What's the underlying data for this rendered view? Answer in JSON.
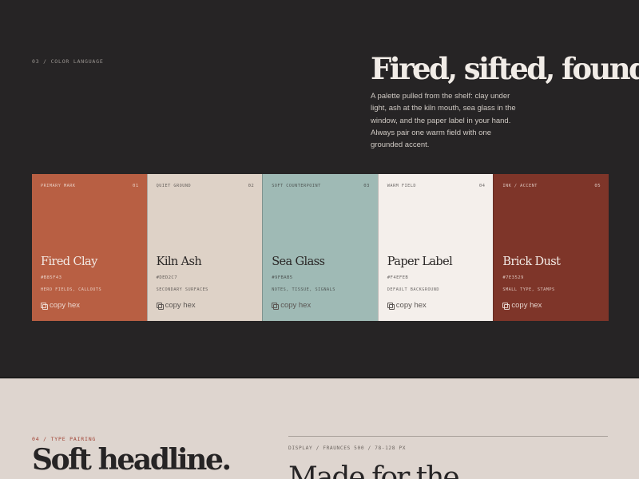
{
  "color_section": {
    "eyebrow": "03 / COLOR LANGUAGE",
    "headline": "Fired, sifted, found.",
    "lede": "A palette pulled from the shelf: clay under light, ash at the kiln mouth, sea glass in the window, and the paper label in your hand. Always pair one warm field with one grounded accent.",
    "copy_label": "copy hex",
    "swatches": [
      {
        "role": "PRIMARY MARK",
        "num": "01",
        "name": "Fired Clay",
        "hex": "#B85F43",
        "use": "HERO FIELDS, CALLOUTS",
        "color": "#B85F43",
        "tone": "on-dark"
      },
      {
        "role": "QUIET GROUND",
        "num": "02",
        "name": "Kiln Ash",
        "hex": "#DED2C7",
        "use": "SECONDARY SURFACES",
        "color": "#DED2C7",
        "tone": "on-light"
      },
      {
        "role": "SOFT COUNTERPOINT",
        "num": "03",
        "name": "Sea Glass",
        "hex": "#9FBAB5",
        "use": "NOTES, TISSUE, SIGNALS",
        "color": "#9FBAB5",
        "tone": "on-light"
      },
      {
        "role": "WARM FIELD",
        "num": "04",
        "name": "Paper Label",
        "hex": "#F4EFEB",
        "use": "DEFAULT BACKGROUND",
        "color": "#F4EFEB",
        "tone": "on-light"
      },
      {
        "role": "INK / ACCENT",
        "num": "05",
        "name": "Brick Dust",
        "hex": "#7E3529",
        "use": "SMALL TYPE, STAMPS",
        "color": "#7E3529",
        "tone": "on-dark"
      }
    ]
  },
  "type_section": {
    "eyebrow": "04 / TYPE PAIRING",
    "headline": "Soft headline.",
    "spec": "DISPLAY / FRAUNCES 500 / 78-128 PX",
    "sample": "Made for the"
  }
}
